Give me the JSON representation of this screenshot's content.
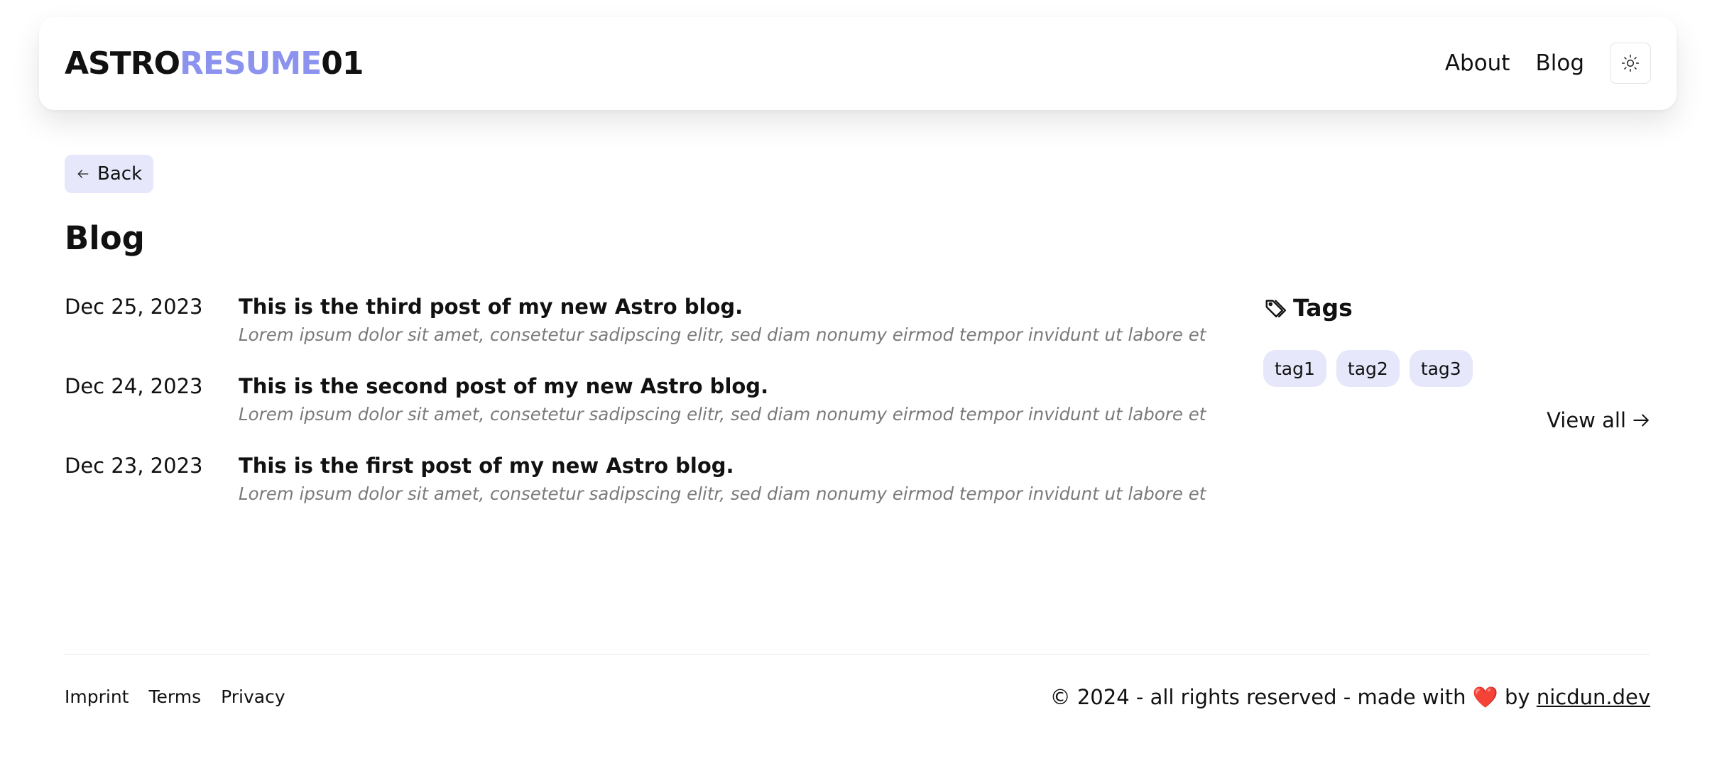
{
  "header": {
    "logo_part1": "ASTRO",
    "logo_part2": "RESUME",
    "logo_part3": "01",
    "nav": [
      {
        "label": "About"
      },
      {
        "label": "Blog"
      }
    ],
    "theme_toggle_icon": "sun-icon"
  },
  "back_button": {
    "label": "Back",
    "icon": "arrow-left-icon"
  },
  "page_title": "Blog",
  "posts": [
    {
      "date": "Dec 25, 2023",
      "title": "This is the third post of my new Astro blog.",
      "excerpt": "Lorem ipsum dolor sit amet, consetetur sadipscing elitr, sed diam nonumy eirmod tempor invidunt ut labore et"
    },
    {
      "date": "Dec 24, 2023",
      "title": "This is the second post of my new Astro blog.",
      "excerpt": "Lorem ipsum dolor sit amet, consetetur sadipscing elitr, sed diam nonumy eirmod tempor invidunt ut labore et"
    },
    {
      "date": "Dec 23, 2023",
      "title": "This is the first post of my new Astro blog.",
      "excerpt": "Lorem ipsum dolor sit amet, consetetur sadipscing elitr, sed diam nonumy eirmod tempor invidunt ut labore et"
    }
  ],
  "tags": {
    "heading": "Tags",
    "icon": "tags-icon",
    "items": [
      "tag1",
      "tag2",
      "tag3"
    ],
    "view_all": "View all"
  },
  "footer": {
    "links": [
      "Imprint",
      "Terms",
      "Privacy"
    ],
    "copyright_prefix": "© 2024 - all rights reserved - made with",
    "heart": "❤️",
    "copyright_by": "by",
    "author_link": "nicdun.dev"
  },
  "colors": {
    "accent": "#8b93ee",
    "pill_bg": "#e6e7fb",
    "excerpt": "#7a7a7a"
  }
}
